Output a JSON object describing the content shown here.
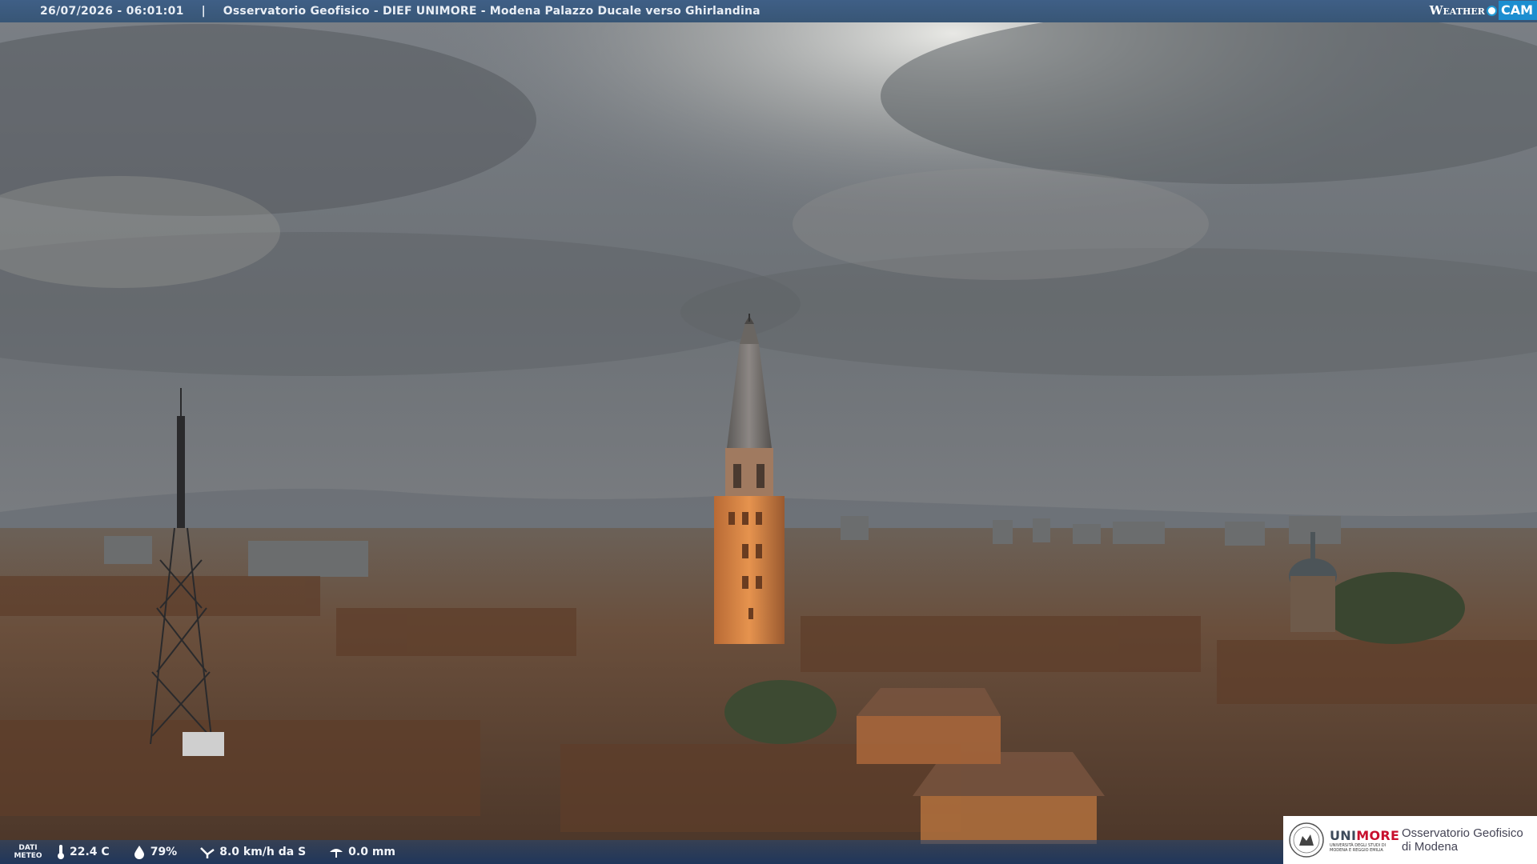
{
  "header": {
    "timestamp": "26/07/2026 - 06:01:01",
    "separator": "|",
    "title": "Osservatorio Geofisico - DIEF UNIMORE - Modena Palazzo Ducale verso Ghirlandina"
  },
  "brand": {
    "weather": "Weather",
    "cam": "CAM"
  },
  "weather_bar": {
    "label_line1": "DATI",
    "label_line2": "METEO",
    "temperature": "22.4 C",
    "humidity": "79%",
    "wind": "8.0 km/h da S",
    "rain": "0.0 mm",
    "icons": [
      "thermometer-icon",
      "humidity-drop-icon",
      "wind-icon",
      "rain-icon"
    ]
  },
  "logo": {
    "uni_prefix": "UNI",
    "uni_suffix": "MORE",
    "uni_sub_line1": "UNIVERSITÀ DEGLI STUDI DI",
    "uni_sub_line2": "MODENA E REGGIO EMILIA",
    "observatory_line1": "Osservatorio Geofisico",
    "observatory_line2": "di Modena"
  },
  "colors": {
    "header_bg": "#3f5f86",
    "brand_blue": "#1c8ed0",
    "unimore_red": "#c8102e"
  }
}
